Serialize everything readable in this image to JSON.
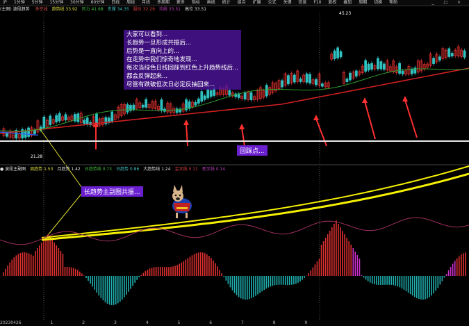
{
  "toolbar": {
    "items": [
      "沪",
      "1分钟",
      "5分钟",
      "15分钟",
      "30分钟",
      "60分钟",
      "日线",
      "周线",
      "月线",
      "多周期",
      "更多",
      "指标",
      "画线",
      "统计",
      "组合",
      "扩展",
      "公式",
      "关键",
      "信息",
      "F10",
      "复权",
      "叠加",
      "周期",
      "切换",
      "帮助"
    ],
    "window_controls": "_ □ ×"
  },
  "main_header": {
    "items": [
      {
        "text": "(主图) 波段趋势 ",
        "color": "#e0e0e0"
      },
      {
        "text": "多空线",
        "color": "#e05050"
      },
      {
        "text": "趋势线 33.92",
        "color": "#e0e040"
      },
      {
        "text": "压力 41.68",
        "color": "#40c040"
      },
      {
        "text": "支撑 34.35",
        "color": "#40c0c0"
      },
      {
        "text": "股价 32.29",
        "color": "#e04040"
      },
      {
        "text": "均线 33.51",
        "color": "#c040c0"
      },
      {
        "text": "高位 33.51",
        "color": "#e0e0e0"
      }
    ]
  },
  "annotation": {
    "lines": [
      "大家可以看到...",
      "长趋势一旦形成共振后...",
      "后势是一直向上的...",
      "在走势中我们惊奇地发现...",
      "每次当绿色日线回踩到红色上升趋势线后...",
      "都会反弹起来...",
      "尽管有跌破但次日必定反抽回来..."
    ],
    "pullback_label": "回踩点...",
    "resonance_label": "长趋势主副图共振..."
  },
  "price_labels": {
    "high": "45.23",
    "low": "21.28"
  },
  "sub_header": {
    "items": [
      {
        "text": "● 波段主副图",
        "color": "#e0e0e0"
      },
      {
        "text": "周趋势 1.53",
        "color": "#e0e040"
      },
      {
        "text": "月趋势 1.42",
        "color": "#e0e0e0"
      },
      {
        "text": "日趋势线 0.73",
        "color": "#40c040"
      },
      {
        "text": "日趋势 0.86",
        "color": "#40c0c0"
      },
      {
        "text": "大趋势线 1.24",
        "color": "#e0e0e0"
      },
      {
        "text": "金叉线 0.11",
        "color": "#e04040"
      },
      {
        "text": "死叉线 0.14",
        "color": "#c040c0"
      }
    ]
  },
  "bottom_bar": {
    "items": [
      "20230426",
      "1",
      "2",
      "3",
      "4",
      "5",
      "6",
      "7",
      "8",
      "9"
    ]
  },
  "colors": {
    "up": "#e03030",
    "down": "#30c0c0",
    "ma_red": "#d02020",
    "ma_green": "#30a030",
    "trend_yellow": "#f5f000",
    "arrow": "#ff3030",
    "magenta": "#d030d0",
    "cyan": "#20b0b0"
  }
}
